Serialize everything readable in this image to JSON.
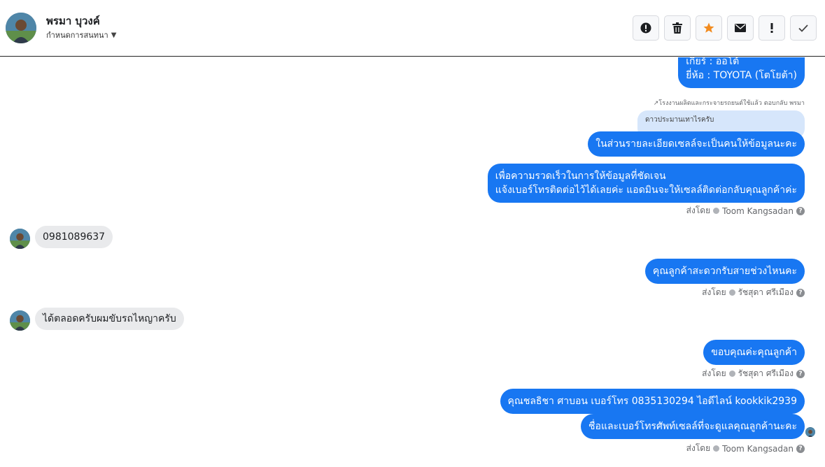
{
  "header": {
    "name": "พรมา บุวงค์",
    "subtitle": "กำหนดการสนทนา",
    "buttons": [
      {
        "icon": "alert-circle-icon",
        "label": "alert"
      },
      {
        "icon": "trash-icon",
        "label": "delete"
      },
      {
        "icon": "star-icon",
        "label": "star",
        "color": "#f28b1f"
      },
      {
        "icon": "mail-icon",
        "label": "mail"
      },
      {
        "icon": "exclamation-icon",
        "label": "exclamation"
      },
      {
        "icon": "check-icon",
        "label": "done"
      }
    ]
  },
  "messages": {
    "car_info_line1": "เกียร์ : ออโต้",
    "car_info_line2": "ยี่ห้อ : TOYOTA (โตโยต้า)",
    "reply_note": "โรงงานผลิตและกระจายรถยนต์ใช้แล้ว ตอบกลับ พรมา",
    "reply_quote": "ดาวประมานเทาไรครับ",
    "msg1": "ในส่วนรายละเอียดเซลล์จะเป็นคนให้ข้อมูลนะคะ",
    "msg2_line1": "เพื่อความรวดเร็วในการให้ข้อมูลที่ชัดเจน",
    "msg2_line2": "แจ้งเบอร์โทรติดต่อไว้ได้เลยค่ะ แอดมินจะให้เซลล์ติดต่อกลับคุณลูกค้าค่ะ",
    "sent_by_1": "ส่งโดย",
    "sender_1": "Toom Kangsadan",
    "in_phone": "0981089637",
    "msg3": "คุณลูกค้าสะดวกรับสายช่วงไหนคะ",
    "sent_by_2": "ส่งโดย",
    "sender_2": "รัชสุดา ศรีเมือง",
    "in_reply": "ได้ตลอดครับผมขับรถไหญาครับ",
    "msg4": "ขอบคุณค่ะคุณลูกค้า",
    "sent_by_3": "ส่งโดย",
    "sender_3": "รัชสุดา ศรีเมือง",
    "msg5": "คุณชลธิชา ศาบอน เบอร์โทร 0835130294 ไอดีไลน์ kookkik2939",
    "msg6": "ชื่อและเบอร์โทรศัพท์เซลล์ที่จะดูแลคุณลูกค้านะคะ",
    "sent_by_4": "ส่งโดย",
    "sender_4": "Toom Kangsadan"
  },
  "colors": {
    "outgoing": "#1877f2",
    "incoming": "#e9eaec",
    "star": "#f28b1f"
  }
}
